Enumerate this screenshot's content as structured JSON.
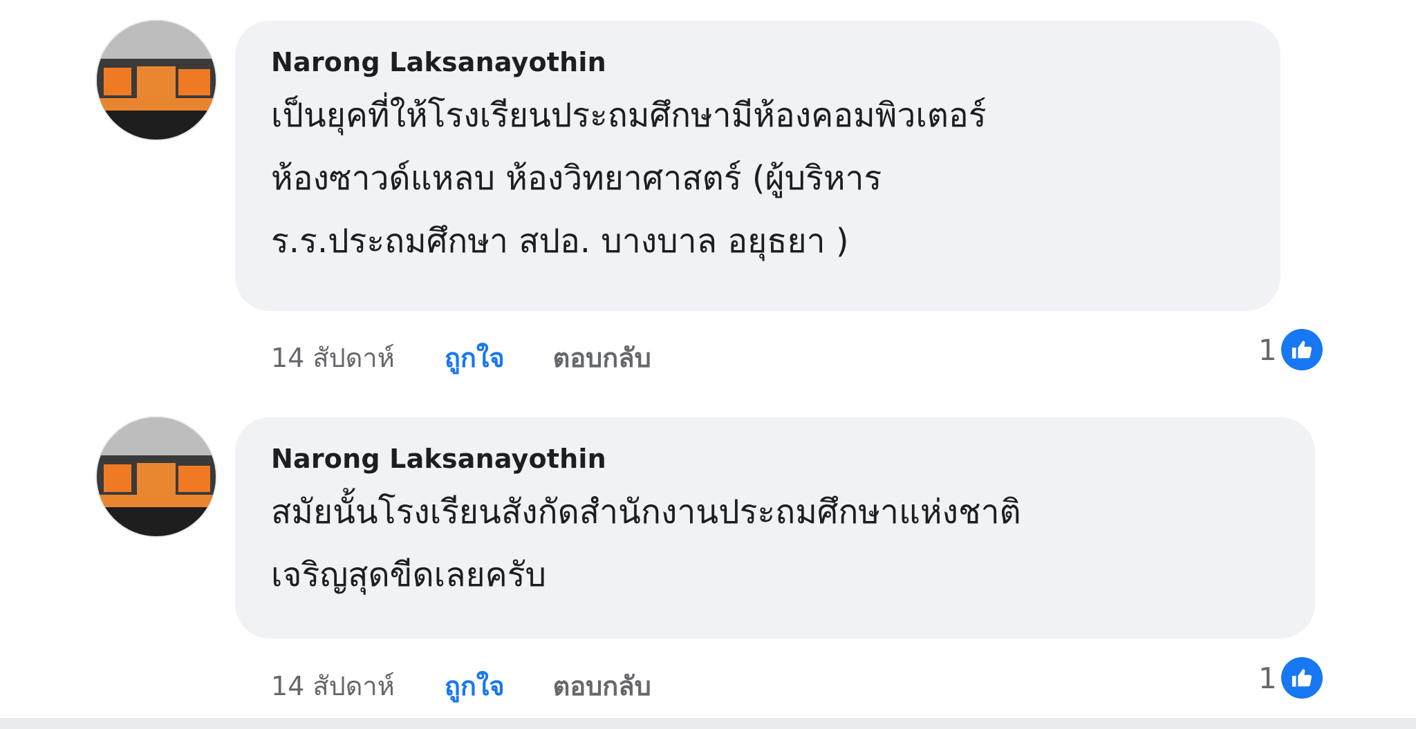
{
  "comments": [
    {
      "author": "Narong Laksanayothin",
      "lines": [
        "เป็นยุคที่ให้โรงเรียนประถมศึกษามีห้องคอมพิวเตอร์",
        "ห้องซาวด์แหลบ ห้องวิทยาศาสตร์ (ผู้บริหาร",
        "ร.ร.ประถมศึกษา สปอ. บางบาล อยุธยา )"
      ],
      "time": "14 สัปดาห์",
      "like_label": "ถูกใจ",
      "reply_label": "ตอบกลับ",
      "reaction_count": "1",
      "reaction_icon": "thumbs-up-icon"
    },
    {
      "author": "Narong Laksanayothin",
      "lines": [
        "สมัยนั้นโรงเรียนสังกัดสำนักงานประถมศึกษาแห่งชาติ",
        "เจริญสุดขีดเลยครับ"
      ],
      "time": "14 สัปดาห์",
      "like_label": "ถูกใจ",
      "reply_label": "ตอบกลับ",
      "reaction_count": "1",
      "reaction_icon": "thumbs-up-icon"
    }
  ],
  "colors": {
    "bubble": "#f0f2f5",
    "like_blue": "#1877f2",
    "meta_gray": "#65676b",
    "text": "#1c1e21"
  }
}
